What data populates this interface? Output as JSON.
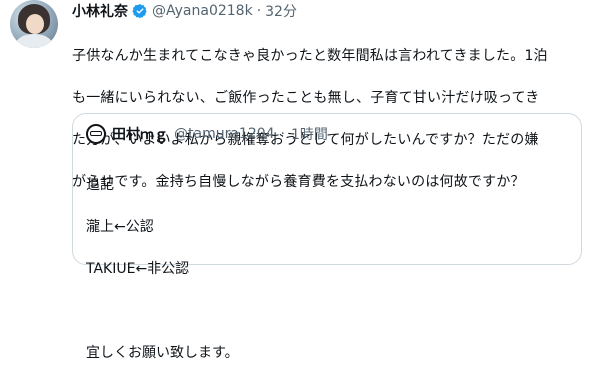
{
  "tweet": {
    "author_name": "小林礼奈",
    "author_handle": "@Ayana0218k",
    "separator": "·",
    "time": "32分",
    "text_lines": [
      "子供なんか生まれてこなきゃ良かったと数年間私は言われてきました。1泊",
      "も一緒にいられない、ご飯作ったことも無し、子育て甘い汁だけ吸ってき",
      "た方が、いよいよ私から親権奪おうとして何がしたいんですか？ただの嫌",
      "がらせです。金持ち自慢しながら養育費を支払わないのは何故ですか？"
    ]
  },
  "quote": {
    "author_name": "田村ｍｇ",
    "author_handle": "@tamura1204",
    "separator": "·",
    "time": "1時間",
    "lines": [
      "追記",
      "瀧上←公認",
      "TAKIUE←非公認",
      "",
      "宜しくお願い致します。"
    ]
  },
  "icons": {
    "verified": "verified-badge-icon",
    "avatar": "profile-avatar",
    "quote_avatar": "quote-avatar"
  },
  "colors": {
    "verified": "#1d9bf0",
    "secondary_text": "#536471",
    "border": "#cfd9de"
  }
}
